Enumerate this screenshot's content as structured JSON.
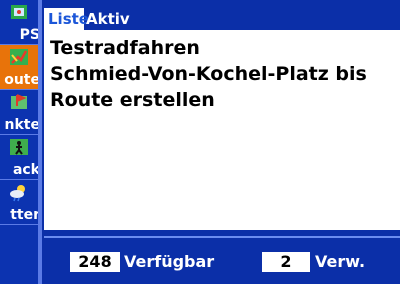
{
  "sidebar": {
    "items": [
      {
        "label": "PS",
        "icon": "gps-icon"
      },
      {
        "label": "oute",
        "icon": "route-icon"
      },
      {
        "label": "nkte",
        "icon": "waypoints-icon"
      },
      {
        "label": "ack",
        "icon": "track-icon"
      },
      {
        "label": "tter",
        "icon": "weather-icon"
      }
    ],
    "active_index": 1
  },
  "tabs": [
    {
      "label": "Liste",
      "active": true
    },
    {
      "label": "Aktiv",
      "active": false
    }
  ],
  "list": {
    "rows": [
      "Testradfahren",
      "Schmied-Von-Kochel-Platz bis",
      "Route erstellen"
    ]
  },
  "footer": {
    "available_count": "248",
    "available_label": "Verfügbar",
    "used_count": "2",
    "used_label": "Verw."
  },
  "colors": {
    "background": "#0b2fa8",
    "active_tab_text": "#1b56d8",
    "active_sidebar": "#e8730a"
  }
}
